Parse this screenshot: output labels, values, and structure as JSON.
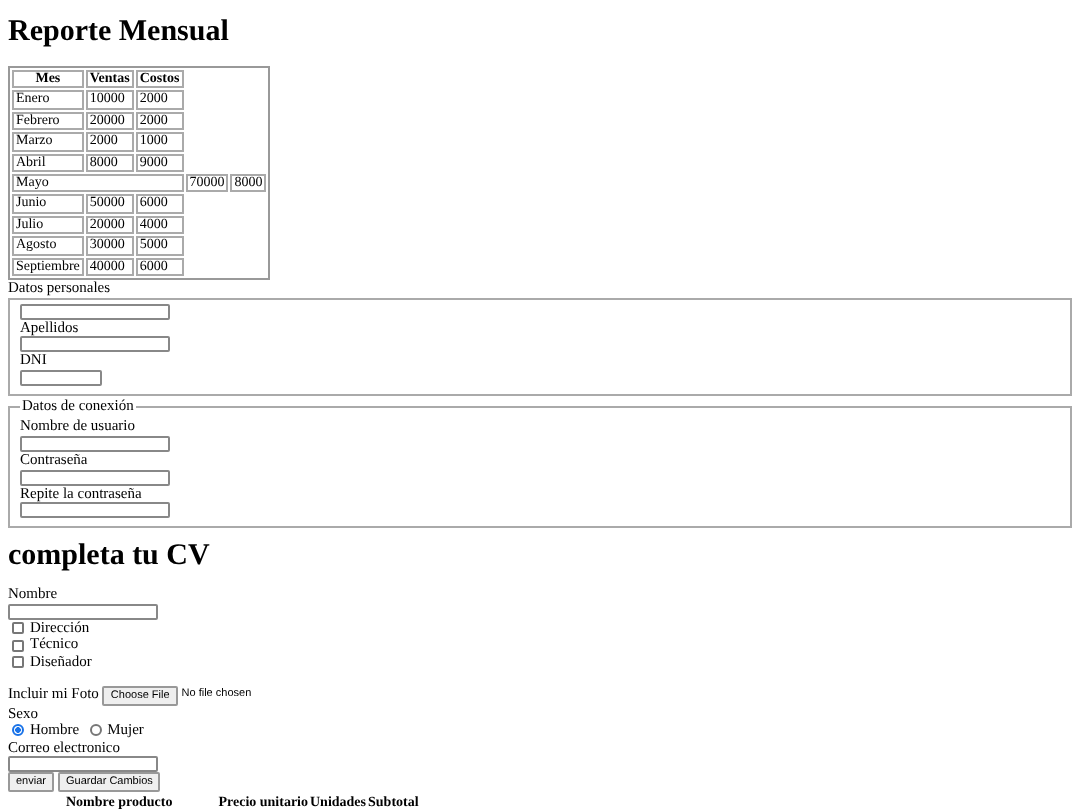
{
  "report": {
    "title": "Reporte Mensual",
    "columns": [
      "Mes",
      "Ventas",
      "Costos"
    ],
    "rows": [
      {
        "kind": "normal",
        "cells": [
          "Enero",
          "10000",
          "2000"
        ]
      },
      {
        "kind": "normal",
        "cells": [
          "Febrero",
          "20000",
          "2000"
        ]
      },
      {
        "kind": "normal",
        "cells": [
          "Marzo",
          "2000",
          "1000"
        ]
      },
      {
        "kind": "normal",
        "cells": [
          "Abril",
          "8000",
          "9000"
        ]
      },
      {
        "kind": "wide",
        "cells": [
          {
            "text": "Mayo",
            "colspan": 3
          },
          {
            "text": "70000"
          },
          {
            "text": "8000"
          }
        ]
      },
      {
        "kind": "normal",
        "cells": [
          "Junio",
          "50000",
          "6000"
        ]
      },
      {
        "kind": "normal",
        "cells": [
          "Julio",
          "20000",
          "4000"
        ]
      },
      {
        "kind": "normal",
        "cells": [
          "Agosto",
          "30000",
          "5000"
        ]
      },
      {
        "kind": "normal",
        "cells": [
          "Septiembre",
          "40000",
          "6000"
        ]
      }
    ]
  },
  "personal": {
    "caption": "Datos personales",
    "fields": [
      {
        "short": false
      },
      {
        "label": "Apellidos",
        "short": false
      },
      {
        "label": "DNI",
        "short": true
      }
    ]
  },
  "connection": {
    "legend": "Datos de conexión",
    "fields": [
      {
        "label": "Nombre de usuario",
        "short": false
      },
      {
        "label": "Contraseña",
        "short": false
      },
      {
        "label": "Repite la contraseña",
        "short": false
      }
    ]
  },
  "cv": {
    "title": "completa tu CV",
    "name_label": "Nombre",
    "roles": [
      {
        "label": "Dirección",
        "checked": false
      },
      {
        "label": "Técnico",
        "checked": false
      },
      {
        "label": "Diseñador",
        "checked": false
      }
    ],
    "photo": {
      "label": "Incluir mi Foto",
      "button": "Choose File",
      "status": "No file chosen"
    },
    "sex": {
      "label": "Sexo",
      "options": [
        {
          "label": "Hombre",
          "selected": true
        },
        {
          "label": "Mujer",
          "selected": false
        }
      ]
    },
    "email_label": "Correo electronico",
    "buttons": [
      "enviar",
      "Guardar Cambios"
    ]
  },
  "products": {
    "columns": [
      "Nombre producto",
      "Precio unitario",
      "Unidades",
      "Subtotal"
    ]
  }
}
